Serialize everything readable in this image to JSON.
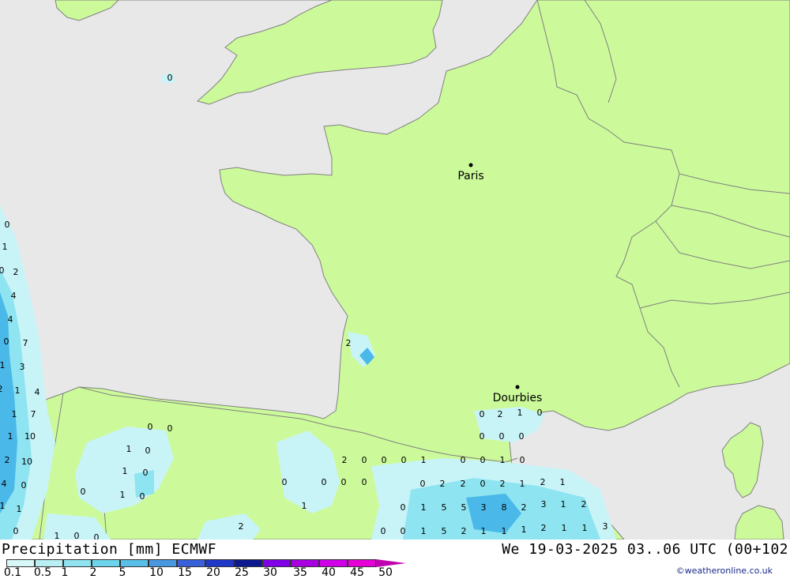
{
  "map": {
    "colors": {
      "sea": "#e8e8e8",
      "land": "#ccfa9a",
      "border": "#808080",
      "precip_light": "#c8f4f8",
      "precip_mid": "#8ee4f0",
      "precip_strong": "#4ab8e8"
    },
    "cities": [
      {
        "name": "Paris",
        "label": "Paris"
      },
      {
        "name": "Dourbies",
        "label": "Dourbies"
      }
    ],
    "values": [
      "0",
      "1",
      "0",
      "2",
      "4",
      "4",
      "0",
      "7",
      "1",
      "3",
      "2",
      "1",
      "4",
      "1",
      "7",
      "1",
      "10",
      "2",
      "10",
      "4",
      "0",
      "1",
      "1",
      "0",
      "0",
      "0",
      "0",
      "1",
      "0",
      "1",
      "0",
      "0",
      "1",
      "0",
      "2",
      "0",
      "0",
      "1",
      "2",
      "0",
      "0",
      "0",
      "1",
      "0",
      "0",
      "1",
      "0",
      "0",
      "0",
      "0",
      "2",
      "1",
      "0",
      "0",
      "0",
      "0",
      "0",
      "2",
      "2",
      "0",
      "2",
      "1",
      "2",
      "1",
      "0",
      "1",
      "5",
      "5",
      "3",
      "8",
      "2",
      "3",
      "1",
      "2",
      "0",
      "0",
      "1",
      "5",
      "2",
      "1",
      "1",
      "1",
      "2",
      "1",
      "1",
      "3",
      "1",
      "0",
      "2",
      "0"
    ]
  },
  "footer": {
    "title_left": "Precipitation [mm] ECMWF",
    "title_right": "We 19-03-2025 03..06 UTC (00+102",
    "credit": "©weatheronline.co.uk",
    "legend": {
      "ticks": [
        "0.1",
        "0.5",
        "1",
        "2",
        "5",
        "10",
        "15",
        "20",
        "25",
        "30",
        "35",
        "40",
        "45",
        "50"
      ],
      "colors": [
        "#d8f8f8",
        "#b8f0f4",
        "#90e4f0",
        "#6cd4ec",
        "#58c0e8",
        "#4898e0",
        "#3860d8",
        "#2038c8",
        "#0c1890",
        "#8000e8",
        "#a800e0",
        "#d000e8",
        "#e800d8",
        "#c000b0"
      ]
    }
  }
}
